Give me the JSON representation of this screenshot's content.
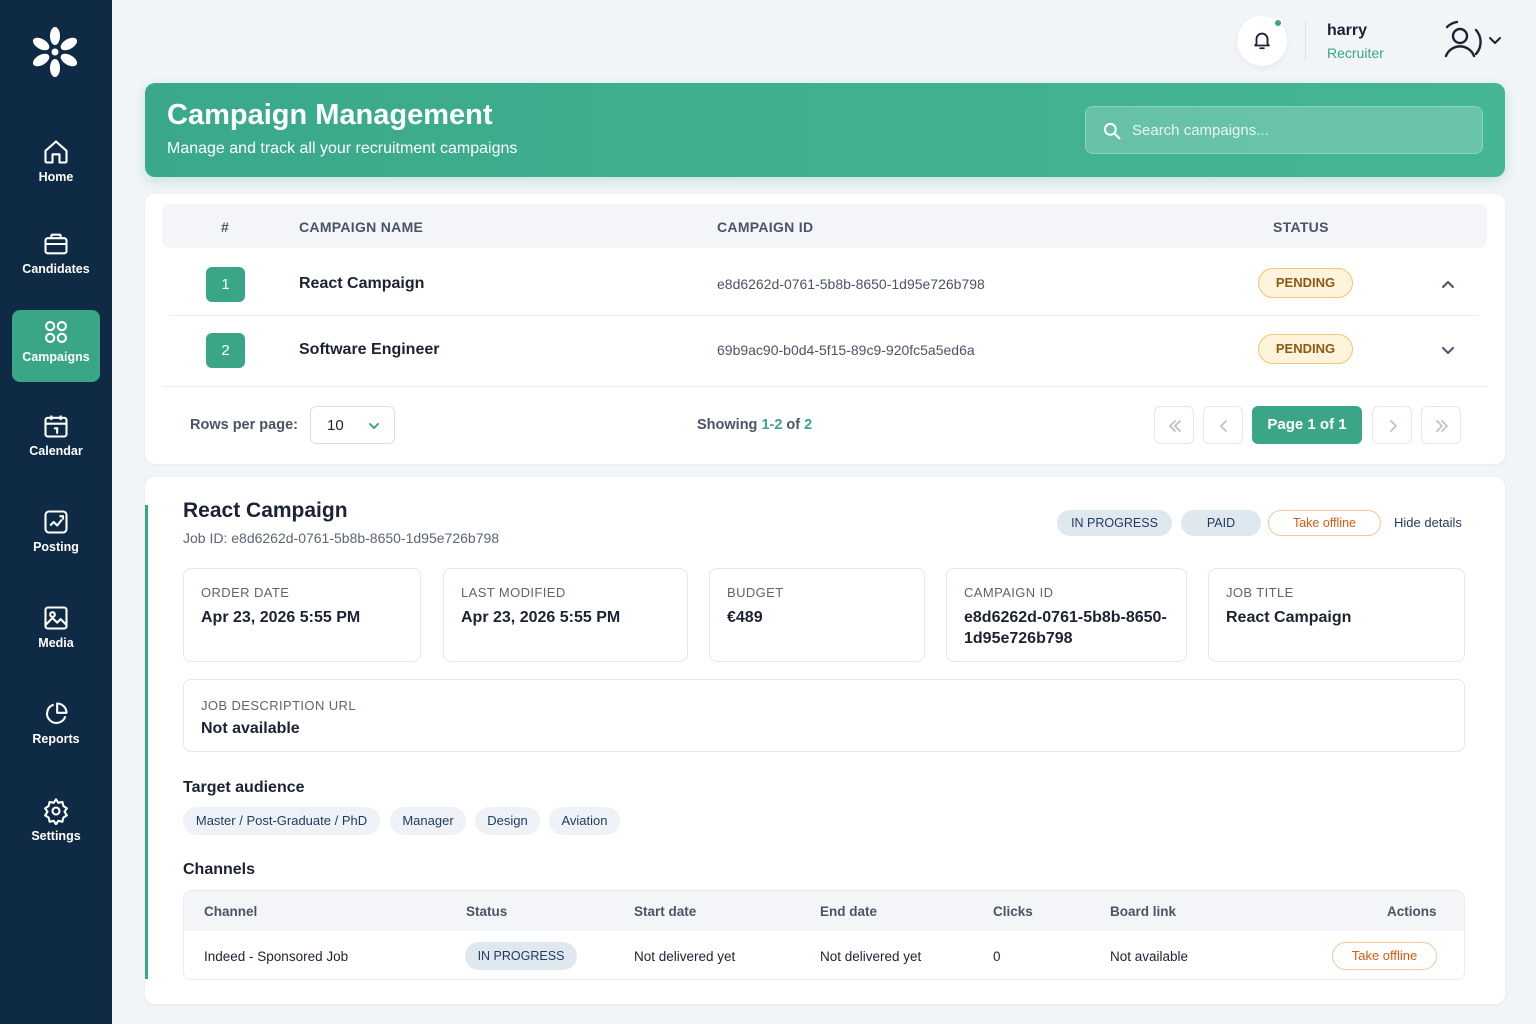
{
  "sidebar": {
    "items": [
      {
        "label": "Home",
        "icon": "home-icon"
      },
      {
        "label": "Candidates",
        "icon": "briefcase-icon"
      },
      {
        "label": "Campaigns",
        "icon": "grid-icon",
        "active": true
      },
      {
        "label": "Calendar",
        "icon": "calendar-icon"
      },
      {
        "label": "Posting",
        "icon": "posting-icon"
      },
      {
        "label": "Media",
        "icon": "image-icon"
      },
      {
        "label": "Reports",
        "icon": "pie-chart-icon"
      },
      {
        "label": "Settings",
        "icon": "gear-icon"
      }
    ]
  },
  "user": {
    "name": "harry",
    "role": "Recruiter"
  },
  "hero": {
    "title": "Campaign Management",
    "subtitle": "Manage and track all your recruitment campaigns",
    "search_placeholder": "Search campaigns..."
  },
  "table": {
    "headers": {
      "num": "#",
      "name": "CAMPAIGN NAME",
      "id": "CAMPAIGN ID",
      "status": "STATUS"
    },
    "rows": [
      {
        "num": "1",
        "name": "React Campaign",
        "id": "e8d6262d-0761-5b8b-8650-1d95e726b798",
        "status": "PENDING",
        "expanded": true
      },
      {
        "num": "2",
        "name": "Software Engineer",
        "id": "69b9ac90-b0d4-5f15-89c9-920fc5a5ed6a",
        "status": "PENDING",
        "expanded": false
      }
    ]
  },
  "pagination": {
    "rows_per_page_label": "Rows per page:",
    "rows_per_page": "10",
    "showing_prefix": "Showing ",
    "showing_range": "1-2",
    "showing_of": " of ",
    "showing_total": "2",
    "page_label": "Page 1 of 1"
  },
  "detail": {
    "title": "React Campaign",
    "job_id": "Job ID: e8d6262d-0761-5b8b-8650-1d95e726b798",
    "status_pill": "IN PROGRESS",
    "payment_pill": "PAID",
    "take_offline": "Take offline",
    "hide_details": "Hide details",
    "fields": {
      "order_date": {
        "label": "ORDER DATE",
        "value": "Apr 23, 2026 5:55 PM"
      },
      "last_modified": {
        "label": "LAST MODIFIED",
        "value": "Apr 23, 2026 5:55 PM"
      },
      "budget": {
        "label": "BUDGET",
        "value": "€489"
      },
      "campaign_id": {
        "label": "CAMPAIGN ID",
        "value": "e8d6262d-0761-5b8b-8650-1d95e726b798"
      },
      "job_title": {
        "label": "JOB TITLE",
        "value": "React Campaign"
      },
      "job_description_url": {
        "label": "JOB DESCRIPTION URL",
        "value": "Not available"
      }
    },
    "target_audience_title": "Target audience",
    "tags": [
      "Master / Post-Graduate / PhD",
      "Manager",
      "Design",
      "Aviation"
    ],
    "channels_title": "Channels",
    "channels": {
      "headers": {
        "channel": "Channel",
        "status": "Status",
        "start": "Start date",
        "end": "End date",
        "clicks": "Clicks",
        "board": "Board link",
        "actions": "Actions"
      },
      "rows": [
        {
          "channel": "Indeed - Sponsored Job",
          "status": "IN PROGRESS",
          "start": "Not delivered yet",
          "end": "Not delivered yet",
          "clicks": "0",
          "board": "Not available",
          "action": "Take offline"
        }
      ]
    }
  },
  "colors": {
    "sidebar": "#0f2a44",
    "accent": "#3aa587",
    "pending_bg": "#fff3dc",
    "offline": "#d65a12"
  }
}
